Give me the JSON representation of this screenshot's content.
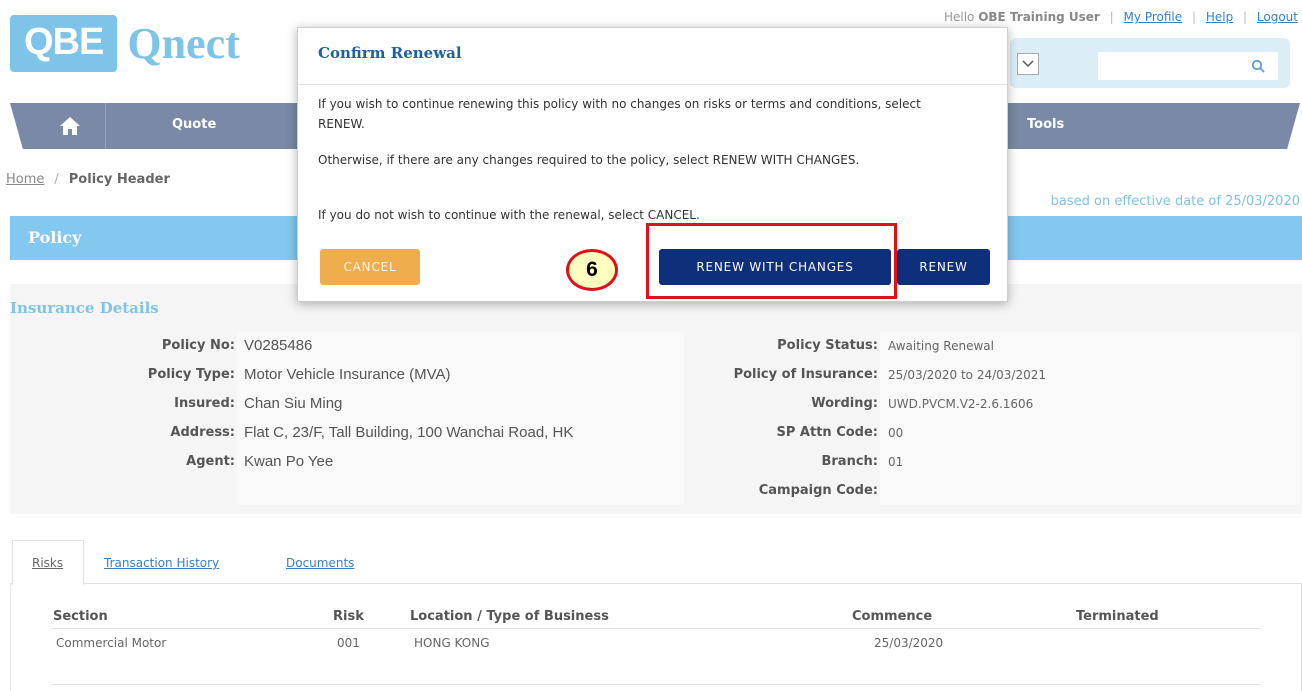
{
  "logo": {
    "box_text": "QBE",
    "name": "Qnect"
  },
  "header": {
    "greeting": "Hello",
    "user_name": "OBE Training User",
    "links": [
      "My Profile",
      "Help",
      "Logout"
    ]
  },
  "nav": {
    "items": [
      "Quote",
      "Tools"
    ]
  },
  "breadcrumb": {
    "home": "Home",
    "current": "Policy Header"
  },
  "effective_note": "based on effective date of 25/03/2020",
  "policy_bar": {
    "title": "Policy"
  },
  "insurance": {
    "title": "Insurance Details",
    "left": [
      {
        "label": "Policy No:",
        "value": "V0285486"
      },
      {
        "label": "Policy Type:",
        "value": "Motor Vehicle Insurance (MVA)"
      },
      {
        "label": "Insured:",
        "value": "Chan Siu Ming"
      },
      {
        "label": "Address:",
        "value": "Flat C, 23/F, Tall Building, 100 Wanchai Road, HK"
      },
      {
        "label": "Agent:",
        "value": "Kwan Po Yee"
      }
    ],
    "right": [
      {
        "label": "Policy Status:",
        "value": "Awaiting Renewal"
      },
      {
        "label": "Policy of Insurance:",
        "value": "25/03/2020 to 24/03/2021"
      },
      {
        "label": "Wording:",
        "value": "UWD.PVCM.V2-2.6.1606"
      },
      {
        "label": "SP Attn Code:",
        "value": "00"
      },
      {
        "label": "Branch:",
        "value": "01"
      },
      {
        "label": "Campaign Code:",
        "value": ""
      }
    ]
  },
  "tabs": [
    "Risks",
    "Transaction History",
    "Documents"
  ],
  "risks_table": {
    "headers": [
      "Section",
      "Risk",
      "Location / Type of Business",
      "Commence",
      "Terminated"
    ],
    "rows": [
      [
        "Commercial Motor",
        "001",
        "HONG KONG",
        "25/03/2020",
        ""
      ]
    ]
  },
  "modal": {
    "title": "Confirm Renewal",
    "p1": "If you wish to continue renewing this policy with no changes on risks or terms and conditions, select RENEW.",
    "p2": "Otherwise, if there are any changes required to the policy, select RENEW WITH CHANGES.",
    "p3": "If you do not wish to continue with the renewal, select CANCEL.",
    "cancel": "CANCEL",
    "renew_with_changes": "RENEW WITH CHANGES",
    "renew": "RENEW"
  },
  "step_badge": "6",
  "colors": {
    "brand": "#7ec3e8",
    "nav": "#7a8aa6",
    "primary_button": "#0e2f7a",
    "cancel_button": "#f0ad4e",
    "highlight": "#e0101a"
  }
}
